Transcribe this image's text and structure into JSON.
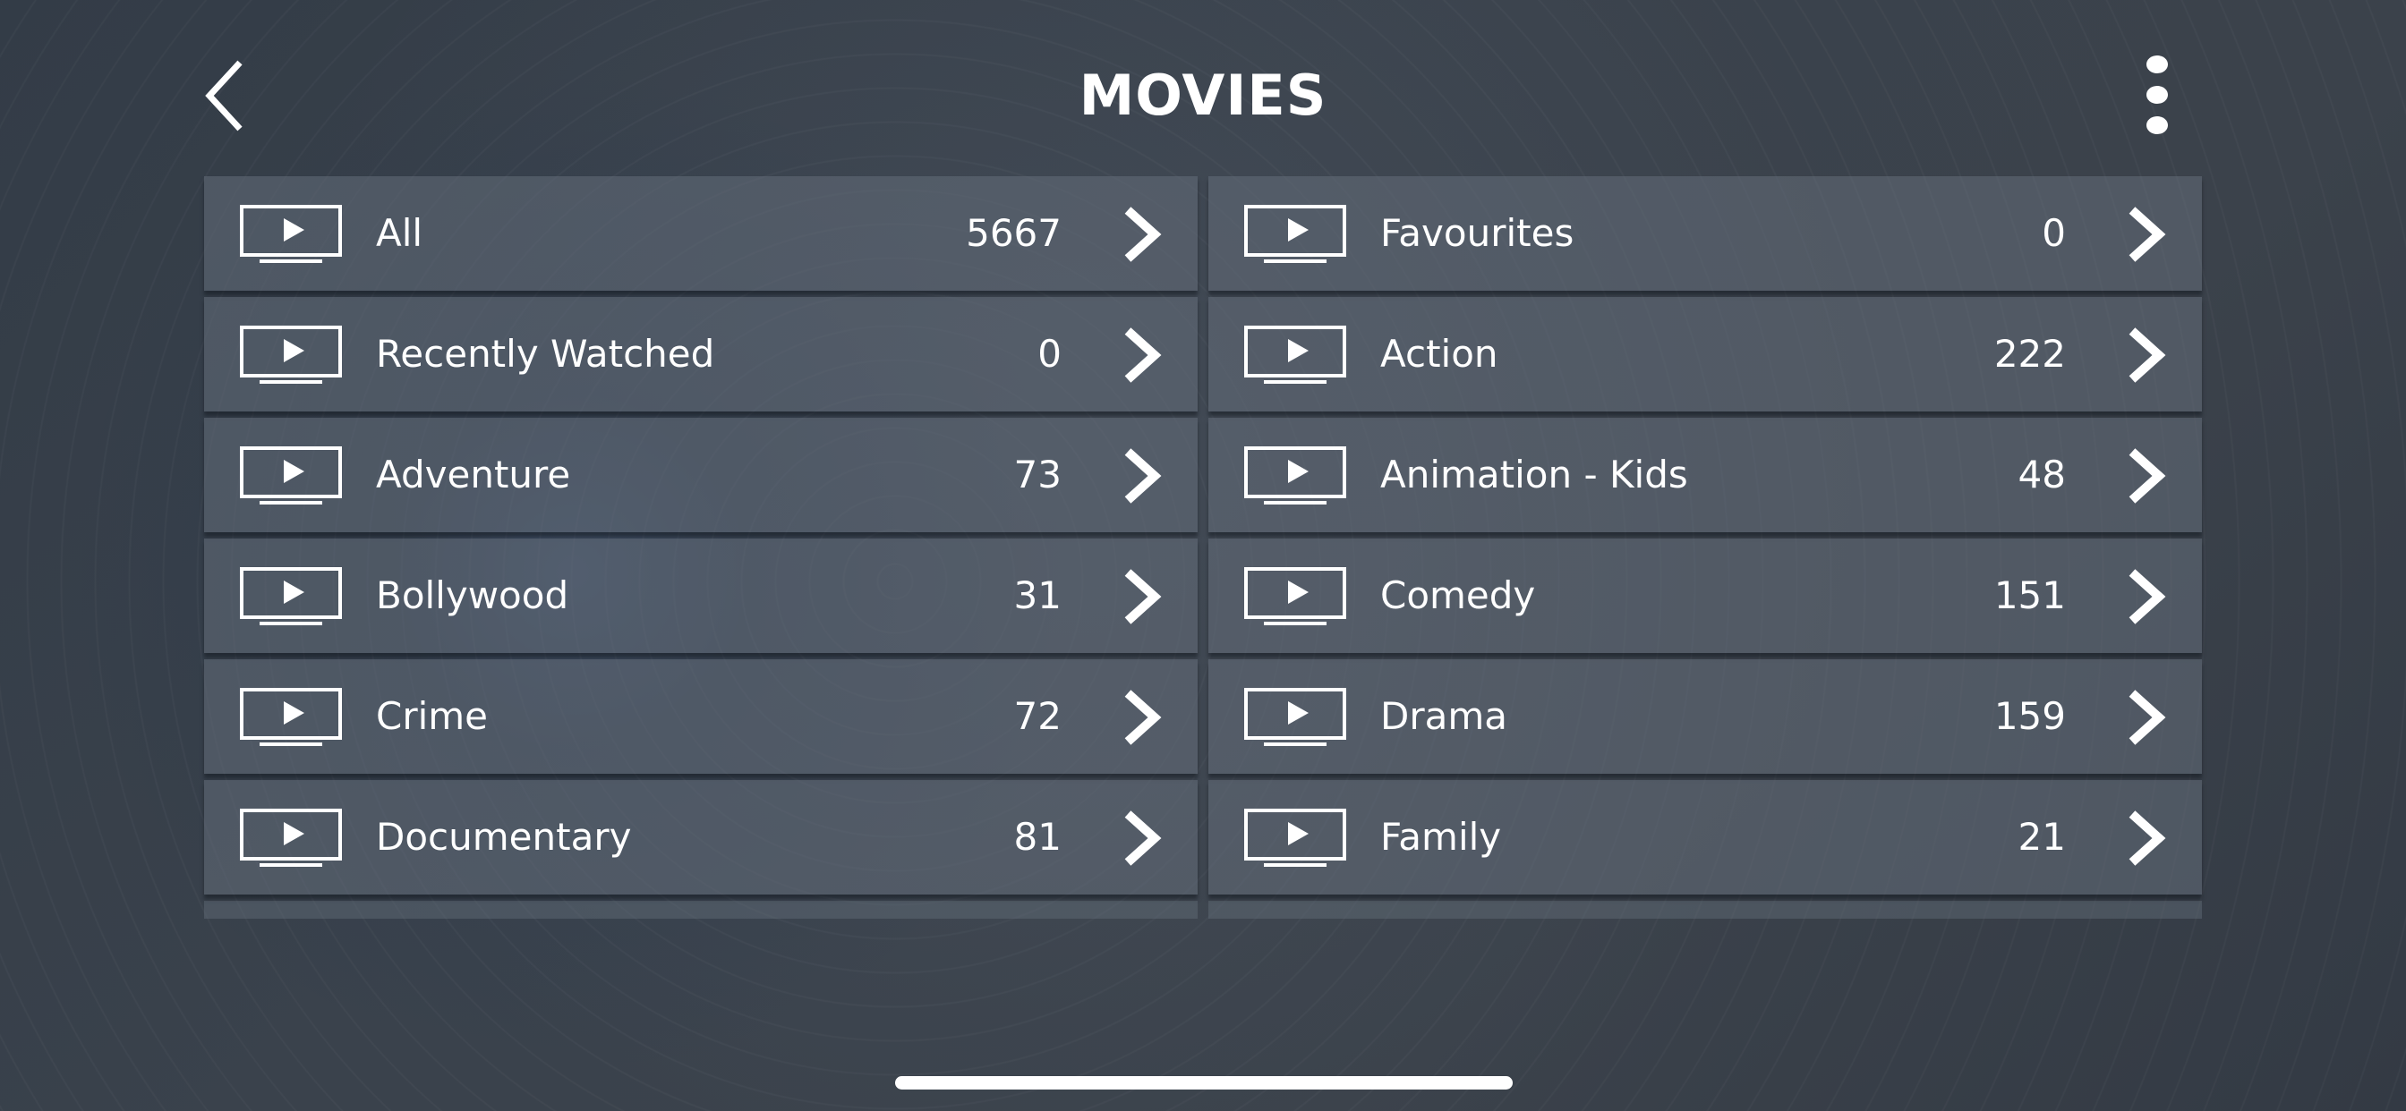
{
  "header": {
    "title": "MOVIES",
    "back_icon": "chevron-left-icon",
    "menu_icon": "more-vertical-icon"
  },
  "categories": [
    {
      "label": "All",
      "count": "5667",
      "icon": "tv-play-icon"
    },
    {
      "label": "Favourites",
      "count": "0",
      "icon": "tv-play-icon"
    },
    {
      "label": "Recently Watched",
      "count": "0",
      "icon": "tv-play-icon"
    },
    {
      "label": "Action",
      "count": "222",
      "icon": "tv-play-icon"
    },
    {
      "label": "Adventure",
      "count": "73",
      "icon": "tv-play-icon"
    },
    {
      "label": "Animation - Kids",
      "count": "48",
      "icon": "tv-play-icon"
    },
    {
      "label": "Bollywood",
      "count": "31",
      "icon": "tv-play-icon"
    },
    {
      "label": "Comedy",
      "count": "151",
      "icon": "tv-play-icon"
    },
    {
      "label": "Crime",
      "count": "72",
      "icon": "tv-play-icon"
    },
    {
      "label": "Drama",
      "count": "159",
      "icon": "tv-play-icon"
    },
    {
      "label": "Documentary",
      "count": "81",
      "icon": "tv-play-icon"
    },
    {
      "label": "Family",
      "count": "21",
      "icon": "tv-play-icon"
    }
  ],
  "colors": {
    "text": "#ffffff",
    "row_bg": "#5b6470",
    "background": "#3a424c"
  }
}
